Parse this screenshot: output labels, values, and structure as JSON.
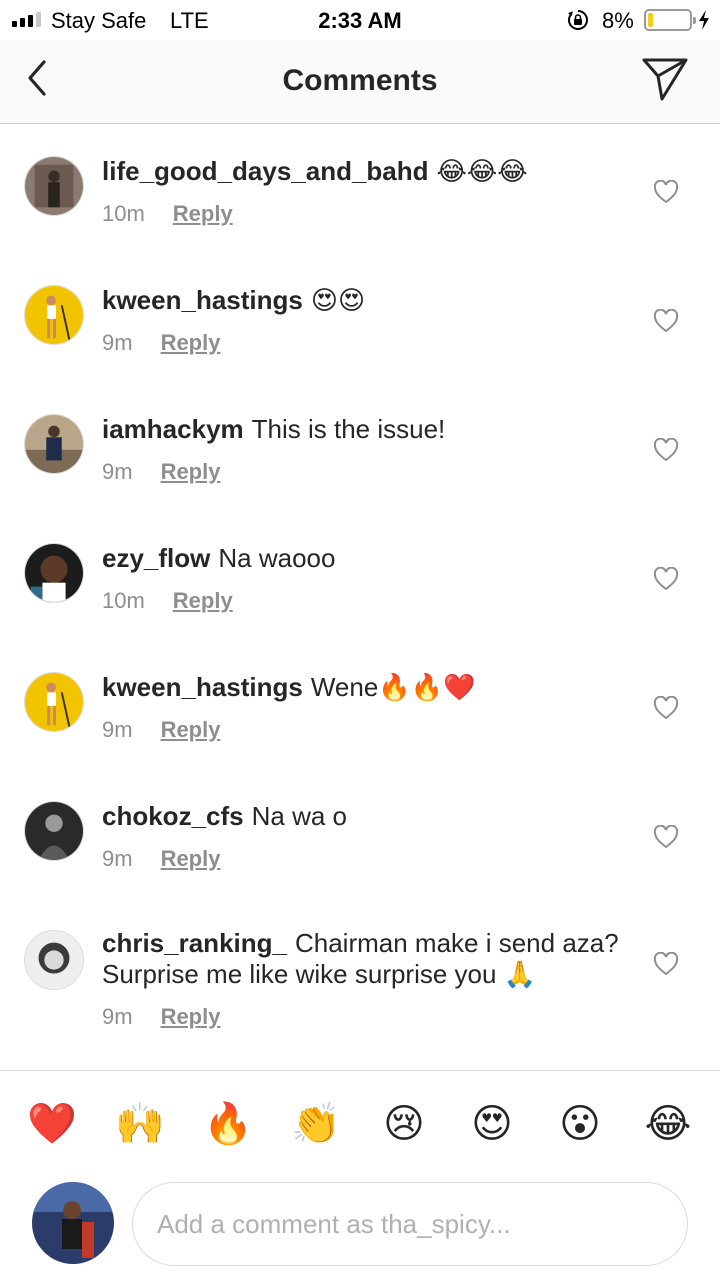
{
  "status_bar": {
    "carrier": "Stay Safe",
    "network": "LTE",
    "time": "2:33 AM",
    "battery_percent": "8%",
    "signal_bars_active": 3,
    "signal_bars_total": 4,
    "battery_level": 0.08
  },
  "header": {
    "title": "Comments",
    "back_icon": "chevron-left-icon",
    "send_icon": "paper-plane-icon"
  },
  "comments": [
    {
      "username": "life_good_days_and_bahd",
      "text": "😂😂😂",
      "time": "10m",
      "reply_label": "Reply"
    },
    {
      "username": "kween_hastings",
      "text": "😍😍",
      "time": "9m",
      "reply_label": "Reply"
    },
    {
      "username": "iamhackym",
      "text": "This is the issue!",
      "time": "9m",
      "reply_label": "Reply"
    },
    {
      "username": "ezy_flow",
      "text": "Na waooo",
      "time": "10m",
      "reply_label": "Reply"
    },
    {
      "username": "kween_hastings",
      "text": "Wene🔥🔥❤️",
      "time": "9m",
      "reply_label": "Reply"
    },
    {
      "username": "chokoz_cfs",
      "text": "Na wa o",
      "time": "9m",
      "reply_label": "Reply"
    },
    {
      "username": "chris_ranking_",
      "text": "Chairman make i send aza? Surprise me like wike surprise you 🙏",
      "time": "9m",
      "reply_label": "Reply"
    }
  ],
  "emoji_bar": [
    "❤️",
    "🙌",
    "🔥",
    "👏",
    "😢",
    "😍",
    "😮",
    "😂"
  ],
  "composer": {
    "placeholder": "Add a comment as tha_spicy..."
  },
  "colors": {
    "text_primary": "#262626",
    "text_secondary": "#8e8e8e",
    "divider": "#dbdbdb",
    "battery_low": "#f4cf1c"
  }
}
